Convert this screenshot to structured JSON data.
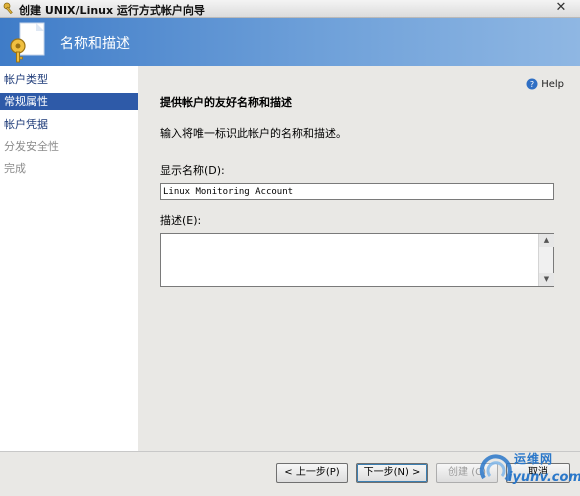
{
  "window": {
    "title": "创建 UNIX/Linux 运行方式帐户向导",
    "close_glyph": "✕"
  },
  "banner": {
    "heading": "名称和描述"
  },
  "sidebar": {
    "items": [
      {
        "label": "帐户类型",
        "state": "visited"
      },
      {
        "label": "常规属性",
        "state": "active"
      },
      {
        "label": "帐户凭据",
        "state": "visited"
      },
      {
        "label": "分发安全性",
        "state": "disabled"
      },
      {
        "label": "完成",
        "state": "disabled"
      }
    ]
  },
  "content": {
    "help_label": "Help",
    "heading": "提供帐户的友好名称和描述",
    "instruction": "输入将唯一标识此帐户的名称和描述。",
    "display_name_label": "显示名称(D):",
    "display_name_value": "Linux Monitoring Account",
    "description_label": "描述(E):",
    "description_value": ""
  },
  "footer": {
    "prev_label": "< 上一步(P)",
    "next_label": "下一步(N) >",
    "create_label": "创建 (C)",
    "cancel_label": "取消"
  },
  "watermark": {
    "text_cn": "运维网",
    "url": "iyunv.com"
  },
  "colors": {
    "banner_start": "#3f7cc8",
    "banner_end": "#8fb7e3",
    "nav_active": "#2e5aa8",
    "nav_visited": "#1d3a78",
    "content_bg": "#e9e8e5",
    "watermark_blue": "#2a77c9"
  }
}
